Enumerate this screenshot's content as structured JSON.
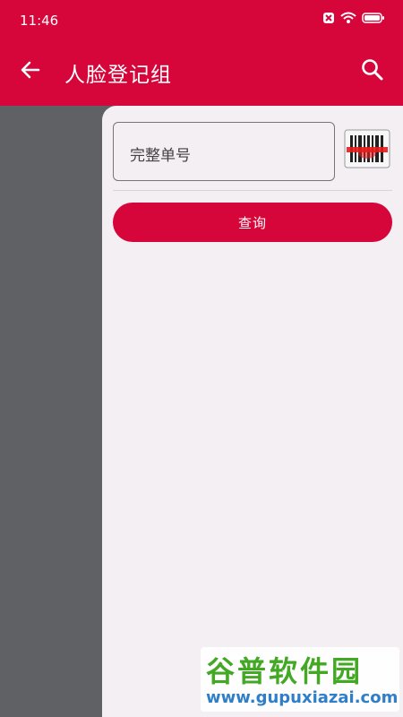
{
  "status_bar": {
    "time": "11:46"
  },
  "toolbar": {
    "title": "人脸登记组",
    "back_icon": "arrow-left-icon",
    "search_icon": "search-icon"
  },
  "form": {
    "order_placeholder": "完整单号",
    "scan_icon": "barcode-scan-icon",
    "query_label": "查询"
  },
  "watermark": {
    "title": "谷普软件园",
    "url": "www.gupuxiazai.com"
  },
  "colors": {
    "primary": "#d6063a",
    "sidebar_bg": "#5f6164",
    "panel_bg": "#f3eff2"
  }
}
